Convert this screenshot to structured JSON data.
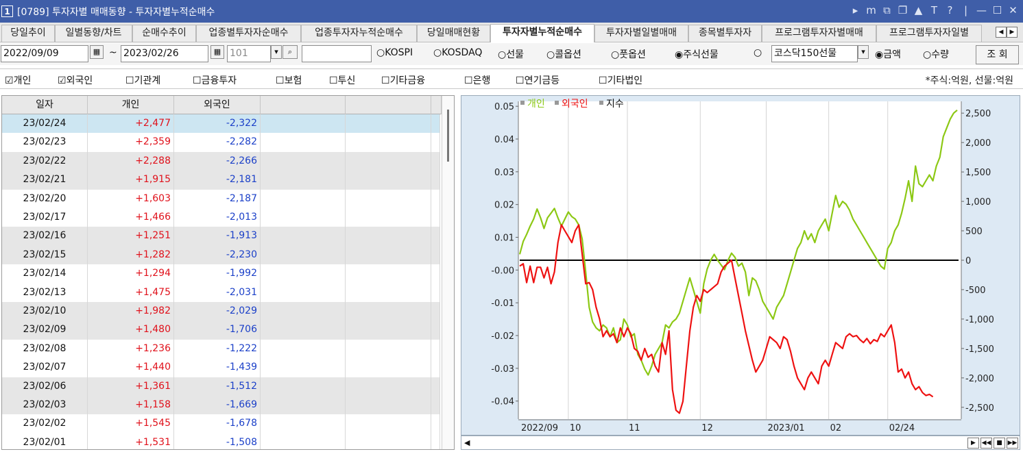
{
  "window": {
    "number": "1",
    "title": "[0789] 투자자별 매매동향 - 투자자별누적순매수",
    "controls": [
      "▸",
      "m",
      "⧉",
      "❐",
      "▲",
      "T",
      "?",
      "|",
      "—",
      "☐",
      "✕"
    ]
  },
  "tabs": [
    {
      "label": "당일추이",
      "active": false
    },
    {
      "label": "일별동향/차트",
      "active": false
    },
    {
      "label": "순매수추이",
      "active": false
    },
    {
      "label": "업종별투자자순매수",
      "active": false
    },
    {
      "label": "업종투자자누적순매수",
      "active": false
    },
    {
      "label": "당일매매현황",
      "active": false
    },
    {
      "label": "투자자별누적순매수",
      "active": true
    },
    {
      "label": "투자자별일별매매",
      "active": false
    },
    {
      "label": "종목별투자자",
      "active": false
    },
    {
      "label": "프로그램투자자별매매",
      "active": false
    },
    {
      "label": "프로그램투자자일별",
      "active": false
    }
  ],
  "toolbar": {
    "start_date": "2022/09/09",
    "tilde": "~",
    "end_date": "2023/02/26",
    "code": "101",
    "code_search": "",
    "market_options": [
      "KOSPI",
      "KOSDAQ",
      "선물",
      "콜옵션",
      "풋옵션",
      "주식선물",
      ""
    ],
    "market_selected": "주식선물",
    "product": "코스닥150선물",
    "unit_options": [
      "금액",
      "수량"
    ],
    "unit_selected": "금액",
    "query_button": "조 회"
  },
  "investors": [
    {
      "label": "개인",
      "checked": true
    },
    {
      "label": "외국인",
      "checked": true
    },
    {
      "label": "기관계",
      "checked": false
    },
    {
      "label": "금융투자",
      "checked": false
    },
    {
      "label": "보험",
      "checked": false
    },
    {
      "label": "투신",
      "checked": false
    },
    {
      "label": "기타금융",
      "checked": false
    },
    {
      "label": "은행",
      "checked": false
    },
    {
      "label": "연기금등",
      "checked": false
    },
    {
      "label": "기타법인",
      "checked": false
    }
  ],
  "unit_note": "*주식:억원, 선물:억원",
  "table": {
    "columns": [
      "일자",
      "개인",
      "외국인",
      "",
      ""
    ],
    "rows": [
      [
        "23/02/24",
        "+2,477",
        "-2,322"
      ],
      [
        "23/02/23",
        "+2,359",
        "-2,282"
      ],
      [
        "23/02/22",
        "+2,288",
        "-2,266"
      ],
      [
        "23/02/21",
        "+1,915",
        "-2,181"
      ],
      [
        "23/02/20",
        "+1,603",
        "-2,187"
      ],
      [
        "23/02/17",
        "+1,466",
        "-2,013"
      ],
      [
        "23/02/16",
        "+1,251",
        "-1,913"
      ],
      [
        "23/02/15",
        "+1,282",
        "-2,230"
      ],
      [
        "23/02/14",
        "+1,294",
        "-1,992"
      ],
      [
        "23/02/13",
        "+1,475",
        "-2,031"
      ],
      [
        "23/02/10",
        "+1,982",
        "-2,029"
      ],
      [
        "23/02/09",
        "+1,480",
        "-1,706"
      ],
      [
        "23/02/08",
        "+1,236",
        "-1,222"
      ],
      [
        "23/02/07",
        "+1,440",
        "-1,439"
      ],
      [
        "23/02/06",
        "+1,361",
        "-1,512"
      ],
      [
        "23/02/03",
        "+1,158",
        "-1,669"
      ],
      [
        "23/02/02",
        "+1,545",
        "-1,678"
      ],
      [
        "23/02/01",
        "+1,531",
        "-1,508"
      ]
    ],
    "selected_row": 0,
    "shaded_pairs": [
      0,
      2,
      3,
      6,
      7,
      10,
      11,
      14,
      15
    ]
  },
  "chart_data": {
    "type": "line",
    "legend": [
      {
        "name": "개인",
        "color": "#8cc814"
      },
      {
        "name": "외국인",
        "color": "#ee1111"
      },
      {
        "name": "지수",
        "color": "#111111"
      }
    ],
    "left_axis": {
      "ticks": [
        "0.05",
        "0.04",
        "0.03",
        "0.02",
        "0.01",
        "-0.00",
        "-0.01",
        "-0.02",
        "-0.03",
        "-0.04"
      ],
      "range": [
        -0.0455,
        0.0515
      ]
    },
    "right_axis": {
      "ticks": [
        "2,500",
        "2,000",
        "1,500",
        "1,000",
        "500",
        "0",
        "-500",
        "-1,000",
        "-1,500",
        "-2,000",
        "-2,500"
      ],
      "range": [
        -2700,
        2700
      ]
    },
    "x_ticks": [
      {
        "label": "2022/09",
        "index": 0
      },
      {
        "label": "10",
        "index": 14
      },
      {
        "label": "11",
        "index": 31
      },
      {
        "label": "12",
        "index": 52
      },
      {
        "label": "2023/01",
        "index": 71
      },
      {
        "label": "02",
        "index": 89
      },
      {
        "label": "02/24",
        "index": 106
      }
    ],
    "zero_line_color": "#000000",
    "series": [
      {
        "name": "개인",
        "color": "#8cc814",
        "values": [
          100,
          320,
          440,
          580,
          700,
          870,
          720,
          540,
          720,
          800,
          880,
          720,
          580,
          700,
          820,
          740,
          700,
          600,
          360,
          -200,
          -800,
          -1050,
          -1150,
          -1200,
          -1100,
          -1150,
          -1300,
          -1150,
          -1400,
          -1350,
          -1000,
          -1100,
          -1300,
          -1250,
          -1600,
          -1700,
          -1850,
          -1950,
          -1800,
          -1600,
          -1500,
          -1400,
          -1100,
          -1150,
          -1050,
          -1000,
          -900,
          -700,
          -500,
          -300,
          -500,
          -700,
          -900,
          -400,
          -150,
          0,
          100,
          0,
          -80,
          -160,
          0,
          120,
          50,
          -100,
          -50,
          -200,
          -600,
          -300,
          -350,
          -500,
          -700,
          -800,
          -900,
          -1000,
          -800,
          -700,
          -600,
          -400,
          -200,
          0,
          200,
          300,
          500,
          350,
          450,
          300,
          500,
          600,
          700,
          500,
          800,
          1100,
          900,
          1000,
          950,
          850,
          700,
          600,
          500,
          400,
          300,
          200,
          100,
          0,
          -100,
          -150,
          200,
          300,
          500,
          600,
          800,
          1050,
          1350,
          1000,
          1600,
          1300,
          1250,
          1350,
          1450,
          1350,
          1600,
          1750,
          2100,
          2250,
          2400,
          2500,
          2550
        ]
      },
      {
        "name": "외국인",
        "color": "#ee1111",
        "values": [
          -100,
          -60,
          -380,
          -100,
          -380,
          -120,
          -120,
          -300,
          -120,
          -400,
          -200,
          300,
          600,
          500,
          400,
          300,
          500,
          600,
          100,
          -400,
          -380,
          -500,
          -800,
          -1000,
          -1300,
          -1200,
          -1300,
          -1250,
          -1400,
          -1150,
          -1300,
          -1150,
          -1250,
          -1500,
          -1550,
          -1700,
          -1500,
          -1650,
          -1600,
          -1800,
          -1900,
          -1400,
          -1600,
          -1200,
          -2200,
          -2550,
          -2600,
          -2400,
          -1800,
          -1200,
          -800,
          -600,
          -700,
          -500,
          -550,
          -500,
          -450,
          -400,
          -200,
          -100,
          -50,
          0,
          -300,
          -600,
          -900,
          -1200,
          -1450,
          -1700,
          -1900,
          -1800,
          -1700,
          -1500,
          -1300,
          -1350,
          -1400,
          -1500,
          -1300,
          -1350,
          -1550,
          -1800,
          -2000,
          -2100,
          -2200,
          -2000,
          -1900,
          -2000,
          -2100,
          -1800,
          -1700,
          -1800,
          -1600,
          -1400,
          -1450,
          -1500,
          -1300,
          -1250,
          -1300,
          -1280,
          -1350,
          -1400,
          -1330,
          -1420,
          -1350,
          -1380,
          -1250,
          -1300,
          -1200,
          -1100,
          -1400,
          -1900,
          -1850,
          -2000,
          -1900,
          -2100,
          -2200,
          -2150,
          -2250,
          -2300,
          -2280,
          -2322
        ]
      }
    ]
  }
}
